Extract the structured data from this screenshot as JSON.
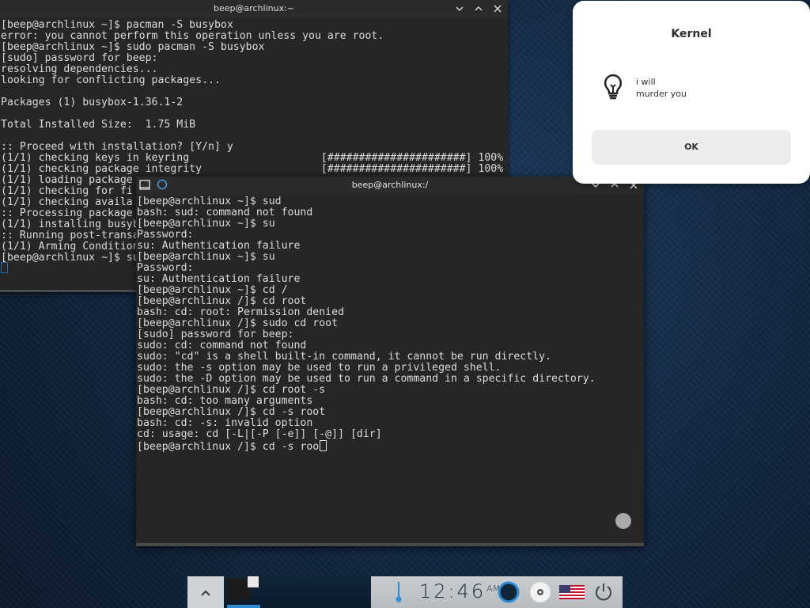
{
  "terminal_back": {
    "title": "beep@archlinux:~",
    "lines": [
      "[beep@archlinux ~]$ pacman -S busybox",
      "error: you cannot perform this operation unless you are root.",
      "[beep@archlinux ~]$ sudo pacman -S busybox",
      "[sudo] password for beep:",
      "resolving dependencies...",
      "looking for conflicting packages...",
      "",
      "Packages (1) busybox-1.36.1-2",
      "",
      "Total Installed Size:  1.75 MiB",
      "",
      ":: Proceed with installation? [Y/n] y",
      "(1/1) checking keys in keyring                     [######################] 100%",
      "(1/1) checking package integrity                   [######################] 100%",
      "(1/1) loading package",
      "(1/1) checking for fi",
      "(1/1) checking availa",
      ":: Processing package",
      "(1/1) installing busyb",
      ":: Running post-transa",
      "(1/1) Arming Condition",
      "[beep@archlinux ~]$ su"
    ]
  },
  "terminal_front": {
    "title": "beep@archlinux:/",
    "lines": [
      "[beep@archlinux ~]$ sud",
      "bash: sud: command not found",
      "[beep@archlinux ~]$ su",
      "Password:",
      "su: Authentication failure",
      "[beep@archlinux ~]$ su",
      "Password:",
      "su: Authentication failure",
      "[beep@archlinux ~]$ cd /",
      "[beep@archlinux /]$ cd root",
      "bash: cd: root: Permission denied",
      "[beep@archlinux /]$ sudo cd root",
      "[sudo] password for beep:",
      "sudo: cd: command not found",
      "sudo: \"cd\" is a shell built-in command, it cannot be run directly.",
      "sudo: the -s option may be used to run a privileged shell.",
      "sudo: the -D option may be used to run a command in a specific directory.",
      "[beep@archlinux /]$ cd root -s",
      "bash: cd: too many arguments",
      "[beep@archlinux /]$ cd -s root",
      "bash: cd: -s: invalid option",
      "cd: usage: cd [-L|[-P [-e]] [-@]] [dir]"
    ],
    "current_input": "[beep@archlinux /]$ cd -s roo"
  },
  "dialog": {
    "title": "Kernel",
    "message_line1": "i will",
    "message_line2": "murder you",
    "ok_label": "OK",
    "icon": "lightbulb-icon"
  },
  "taskbar": {
    "clock_time": "12:46",
    "clock_ampm": "AM",
    "icons": [
      "chevron-up-icon",
      "thermometer-icon",
      "ring-icon",
      "disc-icon",
      "us-flag-icon",
      "power-icon"
    ],
    "accent": "#2c8cd6"
  }
}
